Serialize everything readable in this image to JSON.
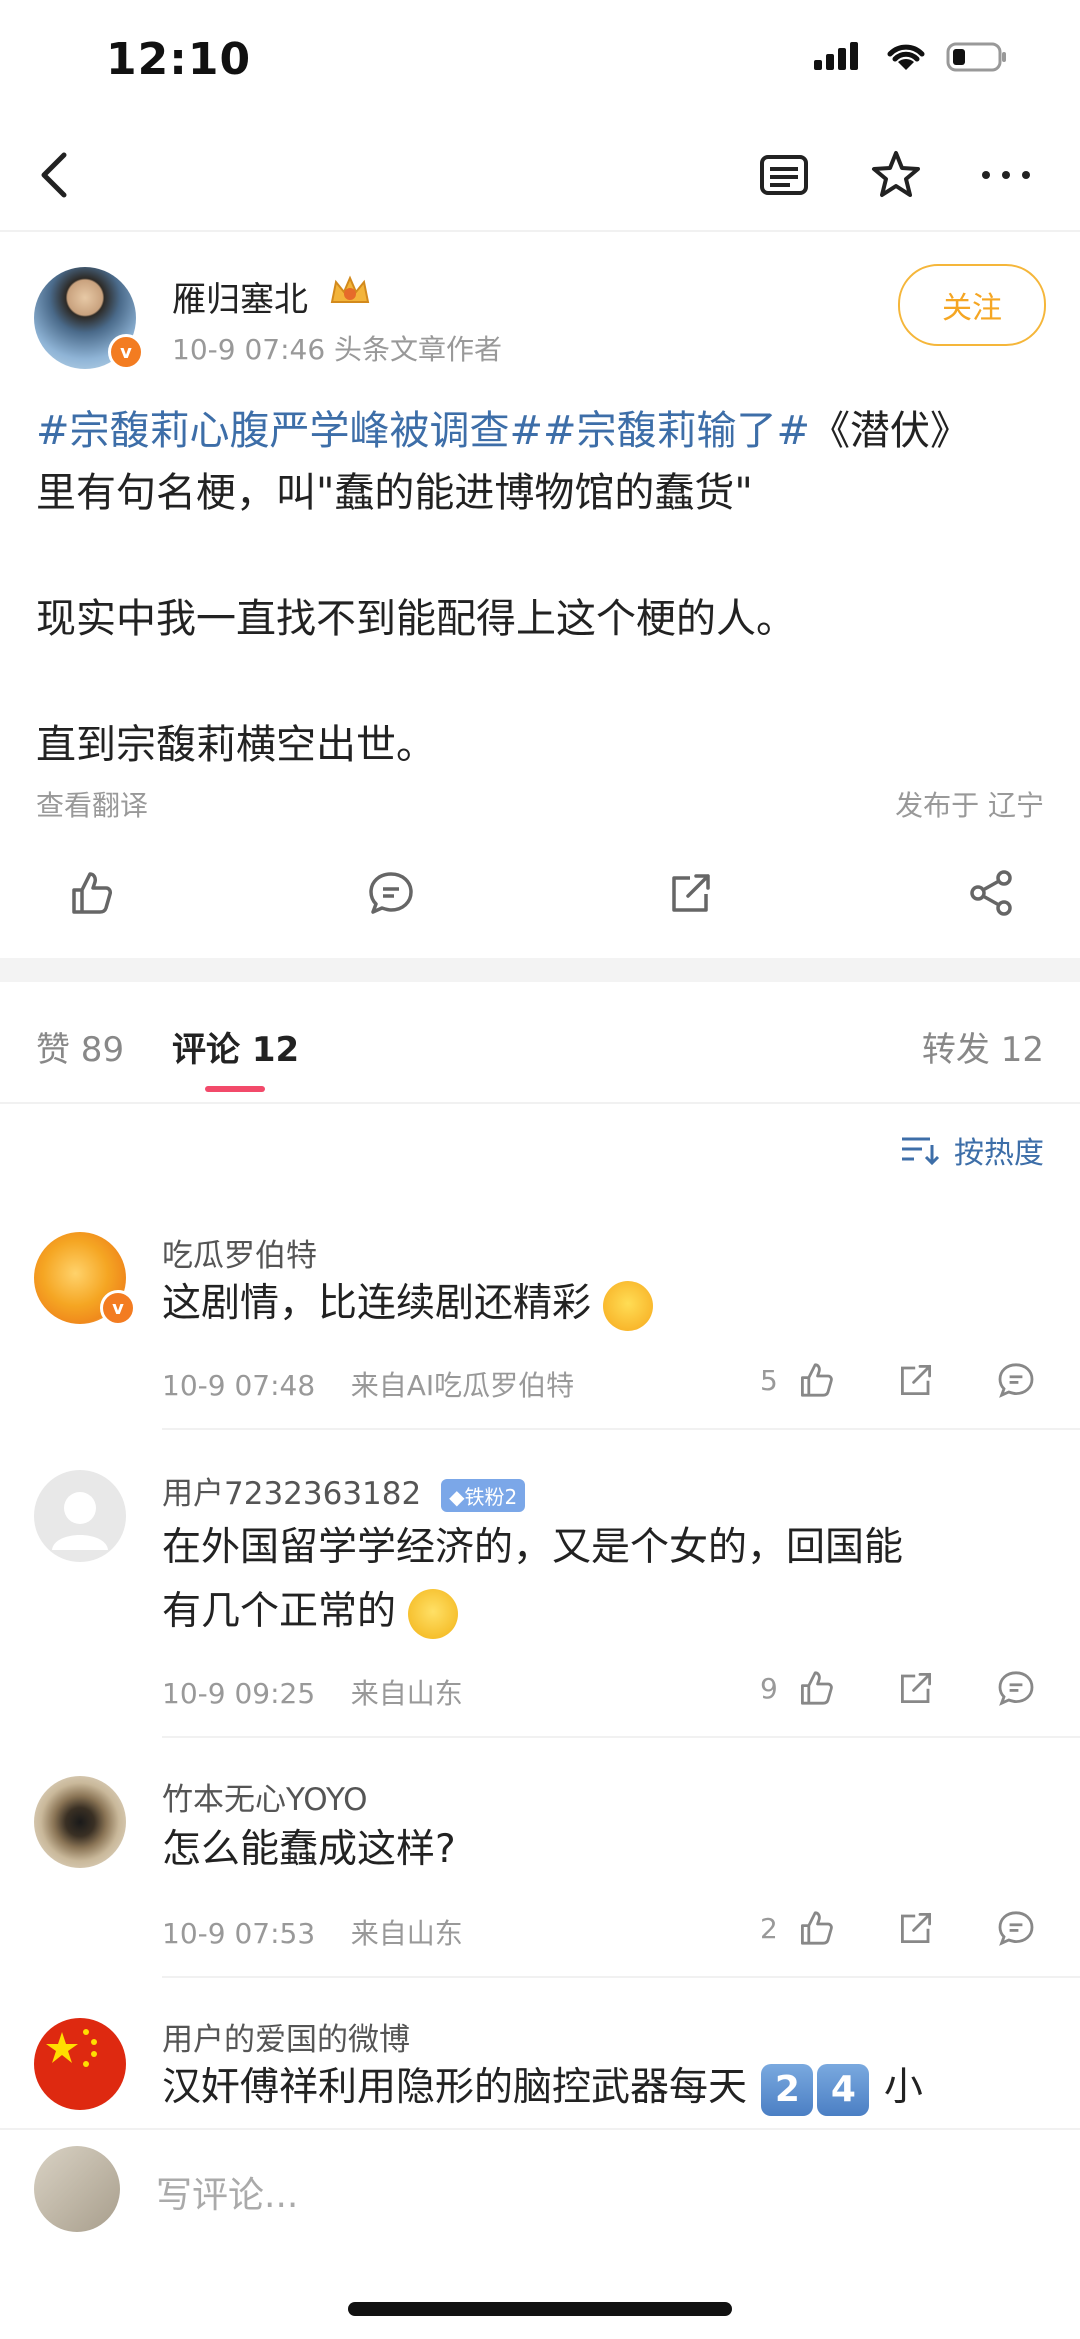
{
  "status_bar": {
    "time": "12:10"
  },
  "post": {
    "author": "雁归塞北",
    "meta": "10-9 07:46   头条文章作者",
    "follow_label": "关注",
    "hashtag1": "#宗馥莉心腹严学峰被调查#",
    "hashtag2": "#宗馥莉输了#",
    "text_line1_rest": "《潜伏》",
    "text_line2": "里有句名梗，叫\"蠢的能进博物馆的蠢货\"",
    "text_para2": "现实中我一直找不到能配得上这个梗的人。",
    "text_para3": "直到宗馥莉横空出世。",
    "translate": "查看翻译",
    "location": "发布于 辽宁"
  },
  "tabs": {
    "likes": "赞 89",
    "comments_label": "评论",
    "comments_count": "12",
    "reposts": "转发 12"
  },
  "sort_label": "按热度",
  "comments": [
    {
      "user": "吃瓜罗伯特",
      "text": "这剧情，比连续剧还精彩",
      "time": "10-9 07:48",
      "source": "来自AI吃瓜罗伯特",
      "likes": "5"
    },
    {
      "user": "用户7232363182",
      "badge": "铁粉2",
      "text_line1": "在外国留学学经济的，又是个女的，回国能",
      "text_line2": "有几个正常的",
      "time": "10-9 09:25",
      "source": "来自山东",
      "likes": "9"
    },
    {
      "user": "竹本无心YOYO",
      "text": "怎么能蠢成这样?",
      "time": "10-9 07:53",
      "source": "来自山东",
      "likes": "2"
    },
    {
      "user": "用户的爱国的微博",
      "text_a": "汉奸傅祥利用隐形的脑控武器每天",
      "key1": "2",
      "key2": "4",
      "text_b": "小"
    }
  ],
  "bottom_bar": {
    "placeholder": "写评论..."
  }
}
